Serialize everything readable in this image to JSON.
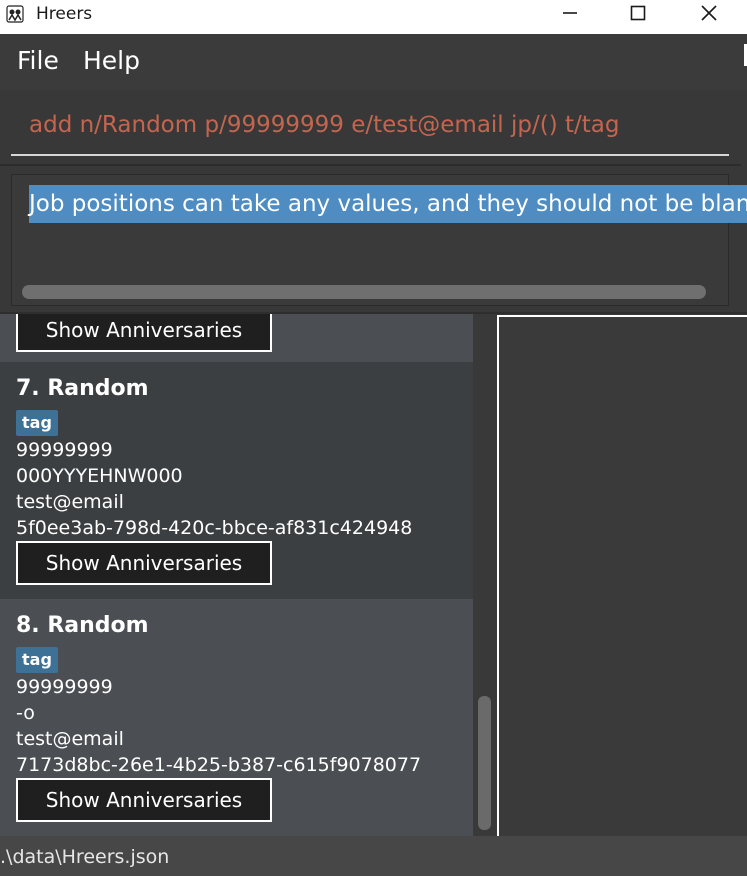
{
  "window": {
    "title": "Hreers",
    "icon": "app-icon",
    "controls": [
      "minimize-icon",
      "maximize-icon",
      "close-icon"
    ]
  },
  "menu": {
    "file": "File",
    "help": "Help"
  },
  "command": {
    "value": "add n/Random p/99999999 e/test@email jp/() t/tag"
  },
  "result": {
    "message": "Job positions can take any values, and they should not be blank."
  },
  "list": {
    "show_anniversaries_label": "Show Anniversaries",
    "persons": [
      {
        "name": "7. Random",
        "tags": [
          "tag"
        ],
        "phone": "99999999",
        "job": "000YYYEHNW000",
        "email": "test@email",
        "id": "5f0ee3ab-798d-420c-bbce-af831c424948"
      },
      {
        "name": "8. Random",
        "tags": [
          "tag"
        ],
        "phone": "99999999",
        "job": "-o",
        "email": "test@email",
        "id": "7173d8bc-26e1-4b25-b387-c615f9078077"
      }
    ]
  },
  "status": {
    "path": ".\\data\\Hreers.json"
  },
  "colors": {
    "background": "#383838",
    "command_text": "#c4654f",
    "highlight": "#4e8cc2",
    "tag": "#3e7196",
    "card_alt": "#4b4e52",
    "card_selected": "#3c3f42"
  }
}
